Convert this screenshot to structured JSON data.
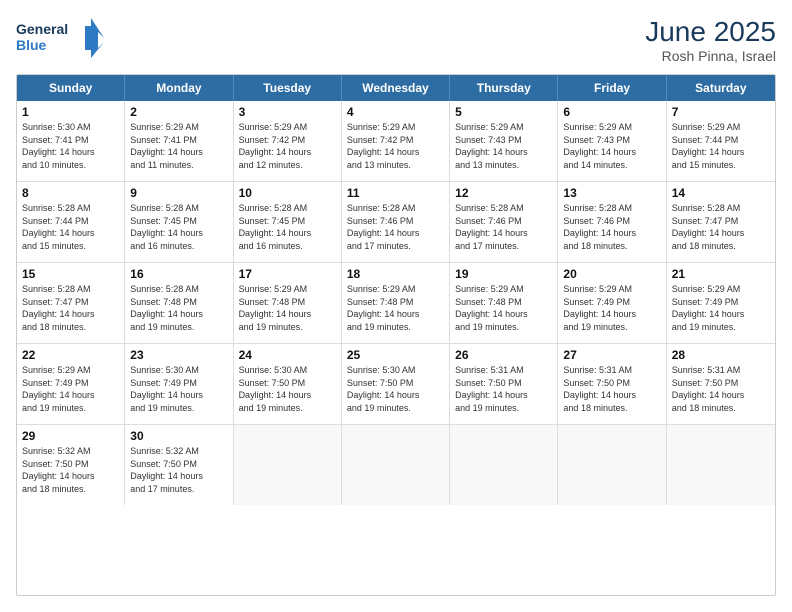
{
  "header": {
    "logo_line1": "General",
    "logo_line2": "Blue",
    "month_year": "June 2025",
    "location": "Rosh Pinna, Israel"
  },
  "weekdays": [
    "Sunday",
    "Monday",
    "Tuesday",
    "Wednesday",
    "Thursday",
    "Friday",
    "Saturday"
  ],
  "rows": [
    [
      {
        "day": "1",
        "lines": [
          "Sunrise: 5:30 AM",
          "Sunset: 7:41 PM",
          "Daylight: 14 hours",
          "and 10 minutes."
        ]
      },
      {
        "day": "2",
        "lines": [
          "Sunrise: 5:29 AM",
          "Sunset: 7:41 PM",
          "Daylight: 14 hours",
          "and 11 minutes."
        ]
      },
      {
        "day": "3",
        "lines": [
          "Sunrise: 5:29 AM",
          "Sunset: 7:42 PM",
          "Daylight: 14 hours",
          "and 12 minutes."
        ]
      },
      {
        "day": "4",
        "lines": [
          "Sunrise: 5:29 AM",
          "Sunset: 7:42 PM",
          "Daylight: 14 hours",
          "and 13 minutes."
        ]
      },
      {
        "day": "5",
        "lines": [
          "Sunrise: 5:29 AM",
          "Sunset: 7:43 PM",
          "Daylight: 14 hours",
          "and 13 minutes."
        ]
      },
      {
        "day": "6",
        "lines": [
          "Sunrise: 5:29 AM",
          "Sunset: 7:43 PM",
          "Daylight: 14 hours",
          "and 14 minutes."
        ]
      },
      {
        "day": "7",
        "lines": [
          "Sunrise: 5:29 AM",
          "Sunset: 7:44 PM",
          "Daylight: 14 hours",
          "and 15 minutes."
        ]
      }
    ],
    [
      {
        "day": "8",
        "lines": [
          "Sunrise: 5:28 AM",
          "Sunset: 7:44 PM",
          "Daylight: 14 hours",
          "and 15 minutes."
        ]
      },
      {
        "day": "9",
        "lines": [
          "Sunrise: 5:28 AM",
          "Sunset: 7:45 PM",
          "Daylight: 14 hours",
          "and 16 minutes."
        ]
      },
      {
        "day": "10",
        "lines": [
          "Sunrise: 5:28 AM",
          "Sunset: 7:45 PM",
          "Daylight: 14 hours",
          "and 16 minutes."
        ]
      },
      {
        "day": "11",
        "lines": [
          "Sunrise: 5:28 AM",
          "Sunset: 7:46 PM",
          "Daylight: 14 hours",
          "and 17 minutes."
        ]
      },
      {
        "day": "12",
        "lines": [
          "Sunrise: 5:28 AM",
          "Sunset: 7:46 PM",
          "Daylight: 14 hours",
          "and 17 minutes."
        ]
      },
      {
        "day": "13",
        "lines": [
          "Sunrise: 5:28 AM",
          "Sunset: 7:46 PM",
          "Daylight: 14 hours",
          "and 18 minutes."
        ]
      },
      {
        "day": "14",
        "lines": [
          "Sunrise: 5:28 AM",
          "Sunset: 7:47 PM",
          "Daylight: 14 hours",
          "and 18 minutes."
        ]
      }
    ],
    [
      {
        "day": "15",
        "lines": [
          "Sunrise: 5:28 AM",
          "Sunset: 7:47 PM",
          "Daylight: 14 hours",
          "and 18 minutes."
        ]
      },
      {
        "day": "16",
        "lines": [
          "Sunrise: 5:28 AM",
          "Sunset: 7:48 PM",
          "Daylight: 14 hours",
          "and 19 minutes."
        ]
      },
      {
        "day": "17",
        "lines": [
          "Sunrise: 5:29 AM",
          "Sunset: 7:48 PM",
          "Daylight: 14 hours",
          "and 19 minutes."
        ]
      },
      {
        "day": "18",
        "lines": [
          "Sunrise: 5:29 AM",
          "Sunset: 7:48 PM",
          "Daylight: 14 hours",
          "and 19 minutes."
        ]
      },
      {
        "day": "19",
        "lines": [
          "Sunrise: 5:29 AM",
          "Sunset: 7:48 PM",
          "Daylight: 14 hours",
          "and 19 minutes."
        ]
      },
      {
        "day": "20",
        "lines": [
          "Sunrise: 5:29 AM",
          "Sunset: 7:49 PM",
          "Daylight: 14 hours",
          "and 19 minutes."
        ]
      },
      {
        "day": "21",
        "lines": [
          "Sunrise: 5:29 AM",
          "Sunset: 7:49 PM",
          "Daylight: 14 hours",
          "and 19 minutes."
        ]
      }
    ],
    [
      {
        "day": "22",
        "lines": [
          "Sunrise: 5:29 AM",
          "Sunset: 7:49 PM",
          "Daylight: 14 hours",
          "and 19 minutes."
        ]
      },
      {
        "day": "23",
        "lines": [
          "Sunrise: 5:30 AM",
          "Sunset: 7:49 PM",
          "Daylight: 14 hours",
          "and 19 minutes."
        ]
      },
      {
        "day": "24",
        "lines": [
          "Sunrise: 5:30 AM",
          "Sunset: 7:50 PM",
          "Daylight: 14 hours",
          "and 19 minutes."
        ]
      },
      {
        "day": "25",
        "lines": [
          "Sunrise: 5:30 AM",
          "Sunset: 7:50 PM",
          "Daylight: 14 hours",
          "and 19 minutes."
        ]
      },
      {
        "day": "26",
        "lines": [
          "Sunrise: 5:31 AM",
          "Sunset: 7:50 PM",
          "Daylight: 14 hours",
          "and 19 minutes."
        ]
      },
      {
        "day": "27",
        "lines": [
          "Sunrise: 5:31 AM",
          "Sunset: 7:50 PM",
          "Daylight: 14 hours",
          "and 18 minutes."
        ]
      },
      {
        "day": "28",
        "lines": [
          "Sunrise: 5:31 AM",
          "Sunset: 7:50 PM",
          "Daylight: 14 hours",
          "and 18 minutes."
        ]
      }
    ],
    [
      {
        "day": "29",
        "lines": [
          "Sunrise: 5:32 AM",
          "Sunset: 7:50 PM",
          "Daylight: 14 hours",
          "and 18 minutes."
        ]
      },
      {
        "day": "30",
        "lines": [
          "Sunrise: 5:32 AM",
          "Sunset: 7:50 PM",
          "Daylight: 14 hours",
          "and 17 minutes."
        ]
      },
      {
        "day": "",
        "lines": []
      },
      {
        "day": "",
        "lines": []
      },
      {
        "day": "",
        "lines": []
      },
      {
        "day": "",
        "lines": []
      },
      {
        "day": "",
        "lines": []
      }
    ]
  ]
}
